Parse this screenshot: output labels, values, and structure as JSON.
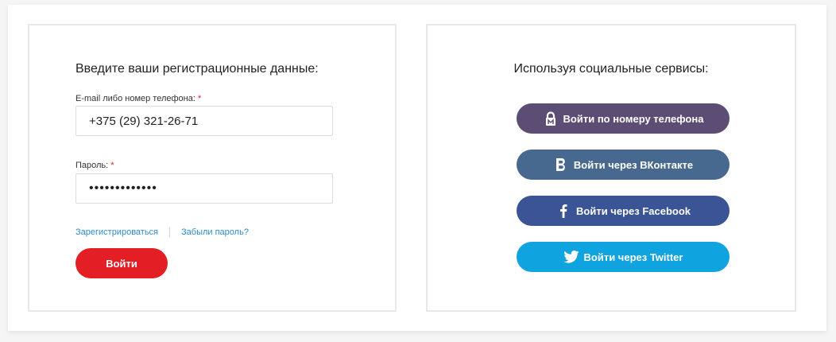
{
  "login_form": {
    "title": "Введите ваши регистрационные данные:",
    "email_label": "E-mail либо номер телефона:",
    "email_value": "+375 (29) 321-26-71",
    "password_label": "Пароль:",
    "password_value": "•••••••••••••",
    "required_mark": "*",
    "register_link": "Зарегистрироваться",
    "forgot_link": "Забыли пароль?",
    "login_button": "Войти"
  },
  "social": {
    "title": "Используя социальные сервисы:",
    "buttons": [
      {
        "label": "Войти по номеру телефона",
        "icon": "lock-icon",
        "color": "#5b4d73"
      },
      {
        "label": "Войти через ВКонтакте",
        "icon": "vk-icon",
        "color": "#47698f"
      },
      {
        "label": "Войти через Facebook",
        "icon": "facebook-icon",
        "color": "#3b5495"
      },
      {
        "label": "Войти через Twitter",
        "icon": "twitter-icon",
        "color": "#0fa3e0"
      }
    ]
  },
  "colors": {
    "accent_red": "#e31e24",
    "link_blue": "#2a8bd2"
  }
}
